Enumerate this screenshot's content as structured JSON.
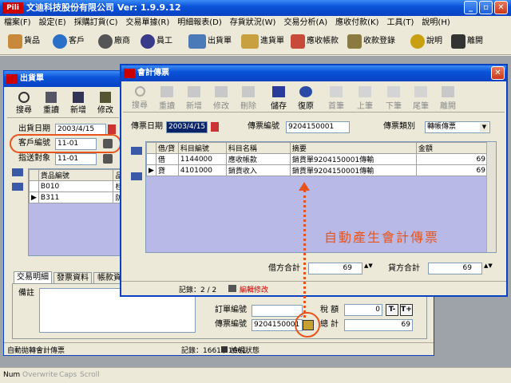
{
  "app": {
    "title": "文迪科技股份有限公司 Ver: 1.9.9.12",
    "logo": "Pili",
    "menu": [
      "檔案(F)",
      "設定(E)",
      "採購訂貨(C)",
      "交易單據(R)",
      "明細報表(D)",
      "存貨狀況(W)",
      "交易分析(A)",
      "應收付款(K)",
      "工具(T)",
      "說明(H)"
    ],
    "toolbar": [
      "貨品",
      "客戶",
      "廠商",
      "員工",
      "出貨單",
      "進貨單",
      "應收帳款",
      "收款登錄",
      "說明",
      "離開"
    ]
  },
  "shipping": {
    "title": "出貨單",
    "tools": [
      "搜尋",
      "重讀",
      "新增",
      "修改"
    ],
    "fields": {
      "date_label": "出貨日期",
      "date_value": "2003/4/15",
      "customer_label": "客戶編號",
      "customer_value": "11-01",
      "ship_label": "指送對象",
      "ship_value": "11-01"
    },
    "grid_headers": [
      "貨品編號",
      "品名"
    ],
    "grid_rows": [
      [
        "B010",
        "桂花香皂"
      ],
      [
        "B311",
        "防脈氣才"
      ]
    ],
    "tabs": [
      "交易明細",
      "發票資料",
      "帳款資料"
    ],
    "note_label": "備註",
    "lower": {
      "order_label": "訂單編號",
      "order_value": "",
      "voucher_label": "傳票編號",
      "voucher_value": "9204150001",
      "tax_label": "稅 額",
      "tax_value": "0",
      "total_label": "總 計",
      "total_value": "69",
      "t_minus": "T-",
      "t_plus": "T+"
    },
    "status_left": "自動拋轉會計傳票",
    "status_record": "記錄：1661 / 1661",
    "status_mode": "檢視狀態"
  },
  "voucher": {
    "title": "會計傳票",
    "tools": [
      "搜尋",
      "重讀",
      "新增",
      "修改",
      "刪除",
      "儲存",
      "復原",
      "首筆",
      "上筆",
      "下筆",
      "尾筆",
      "離開"
    ],
    "date_label": "傳票日期",
    "date_value": "2003/4/15",
    "no_label": "傳票編號",
    "no_value": "9204150001",
    "type_label": "傳票類別",
    "type_value": "轉帳傳票",
    "headers": [
      "借/貸",
      "科目編號",
      "科目名稱",
      "摘要",
      "金額"
    ],
    "rows": [
      [
        "借",
        "1144000",
        "應收帳款",
        "銷貨單9204150001傳輸",
        "69"
      ],
      [
        "貸",
        "4101000",
        "銷貨收入",
        "銷貨單9204150001傳輸",
        "69"
      ]
    ],
    "debit_label": "借方合計",
    "debit_value": "69",
    "credit_label": "貸方合計",
    "credit_value": "69",
    "status_record": "記錄：2 / 2",
    "status_mode": "編輯修改"
  },
  "annotation": "自動產生會計傳票",
  "bottom_status": [
    "Num",
    "Overwrite",
    "Caps",
    "Scroll"
  ],
  "colors": {
    "accent_red": "#e8541c",
    "selection": "#0a246a",
    "grid_bg": "#b9b9e8"
  }
}
